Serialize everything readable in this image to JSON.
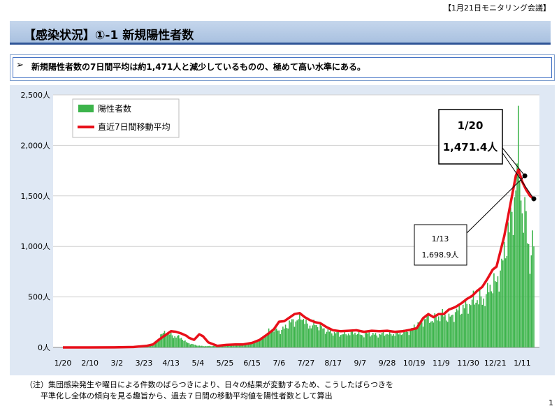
{
  "header": {
    "meeting_label": "【1月21日モニタリング会議】"
  },
  "title": "【感染状況】①-1 新規陽性者数",
  "summary": {
    "marker": "➢",
    "text": "新規陽性者数の7日間平均は約1,471人と減少しているものの、極めて高い水準にある。"
  },
  "note": {
    "line1": "（注）集団感染発生や曜日による件数のばらつきにより、日々の結果が変動するため、こうしたばらつきを",
    "line2": "平準化し全体の傾向を見る趣旨から、過去７日間の移動平均値を陽性者数として算出"
  },
  "page_number": "1",
  "colors": {
    "bars": "#3cb44b",
    "avg_line": "#e8101a",
    "title_band": "#b8cde8",
    "plot_bg": "#ffffff",
    "frame_bg": "#dfe8f4"
  },
  "chart_data": {
    "type": "bar",
    "x_start": "1/20",
    "x_end": "1/20",
    "x_ticks": [
      "1/20",
      "2/10",
      "3/2",
      "3/23",
      "4/13",
      "5/4",
      "5/25",
      "6/15",
      "7/6",
      "7/27",
      "8/17",
      "9/7",
      "9/28",
      "10/19",
      "11/9",
      "11/30",
      "12/21",
      "1/11"
    ],
    "y_ticks": [
      "0人",
      "500人",
      "1,000人",
      "1,500人",
      "2,000人",
      "2,500人"
    ],
    "ylim": [
      0,
      2500
    ],
    "grid": "horizontal",
    "legend": {
      "position": "top-left",
      "bars": "陽性者数",
      "line": "直近7日間移動平均"
    },
    "series": [
      {
        "name": "陽性者数",
        "kind": "bar",
        "points": [
          [
            0,
            0
          ],
          [
            40,
            1
          ],
          [
            60,
            2
          ],
          [
            65,
            6
          ],
          [
            70,
            40
          ],
          [
            73,
            60
          ],
          [
            76,
            150
          ],
          [
            80,
            185
          ],
          [
            86,
            140
          ],
          [
            92,
            120
          ],
          [
            95,
            70
          ],
          [
            100,
            40
          ],
          [
            106,
            20
          ],
          [
            112,
            15
          ],
          [
            120,
            20
          ],
          [
            127,
            25
          ],
          [
            134,
            45
          ],
          [
            140,
            35
          ],
          [
            148,
            60
          ],
          [
            155,
            110
          ],
          [
            160,
            190
          ],
          [
            164,
            230
          ],
          [
            168,
            200
          ],
          [
            172,
            230
          ],
          [
            176,
            300
          ],
          [
            182,
            330
          ],
          [
            186,
            380
          ],
          [
            190,
            260
          ],
          [
            196,
            280
          ],
          [
            200,
            250
          ],
          [
            205,
            200
          ],
          [
            210,
            180
          ],
          [
            216,
            160
          ],
          [
            222,
            170
          ],
          [
            228,
            180
          ],
          [
            232,
            150
          ],
          [
            238,
            170
          ],
          [
            244,
            150
          ],
          [
            250,
            170
          ],
          [
            255,
            160
          ],
          [
            260,
            170
          ],
          [
            265,
            180
          ],
          [
            270,
            200
          ],
          [
            275,
            280
          ],
          [
            278,
            280
          ],
          [
            282,
            360
          ],
          [
            284,
            350
          ],
          [
            288,
            330
          ],
          [
            292,
            380
          ],
          [
            296,
            400
          ],
          [
            300,
            350
          ],
          [
            305,
            420
          ],
          [
            310,
            480
          ],
          [
            314,
            500
          ],
          [
            318,
            560
          ],
          [
            322,
            600
          ],
          [
            326,
            570
          ],
          [
            330,
            660
          ],
          [
            334,
            800
          ],
          [
            337,
            760
          ],
          [
            340,
            950
          ],
          [
            343,
            1100
          ],
          [
            346,
            1450
          ],
          [
            349,
            1500
          ],
          [
            352,
            2050
          ],
          [
            354,
            2400
          ],
          [
            357,
            1700
          ],
          [
            360,
            1500
          ],
          [
            363,
            1100
          ],
          [
            365,
            1200
          ],
          [
            366,
            1250
          ]
        ]
      },
      {
        "name": "直近7日間移動平均",
        "kind": "line",
        "points": [
          [
            0,
            0
          ],
          [
            40,
            1
          ],
          [
            55,
            4
          ],
          [
            65,
            15
          ],
          [
            70,
            30
          ],
          [
            75,
            80
          ],
          [
            80,
            125
          ],
          [
            84,
            160
          ],
          [
            88,
            155
          ],
          [
            92,
            138
          ],
          [
            96,
            115
          ],
          [
            98,
            95
          ],
          [
            102,
            75
          ],
          [
            106,
            130
          ],
          [
            109,
            110
          ],
          [
            113,
            50
          ],
          [
            120,
            15
          ],
          [
            127,
            25
          ],
          [
            134,
            30
          ],
          [
            140,
            30
          ],
          [
            147,
            45
          ],
          [
            153,
            75
          ],
          [
            159,
            130
          ],
          [
            164,
            180
          ],
          [
            168,
            255
          ],
          [
            172,
            260
          ],
          [
            176,
            295
          ],
          [
            180,
            330
          ],
          [
            184,
            340
          ],
          [
            188,
            300
          ],
          [
            192,
            270
          ],
          [
            196,
            250
          ],
          [
            200,
            240
          ],
          [
            205,
            200
          ],
          [
            210,
            170
          ],
          [
            216,
            160
          ],
          [
            222,
            165
          ],
          [
            228,
            170
          ],
          [
            234,
            155
          ],
          [
            240,
            165
          ],
          [
            246,
            160
          ],
          [
            252,
            165
          ],
          [
            258,
            155
          ],
          [
            264,
            160
          ],
          [
            270,
            175
          ],
          [
            275,
            190
          ],
          [
            280,
            290
          ],
          [
            284,
            330
          ],
          [
            288,
            300
          ],
          [
            292,
            330
          ],
          [
            296,
            330
          ],
          [
            300,
            375
          ],
          [
            305,
            400
          ],
          [
            310,
            440
          ],
          [
            314,
            480
          ],
          [
            318,
            510
          ],
          [
            322,
            560
          ],
          [
            326,
            600
          ],
          [
            330,
            680
          ],
          [
            334,
            770
          ],
          [
            337,
            800
          ],
          [
            340,
            950
          ],
          [
            343,
            1100
          ],
          [
            346,
            1300
          ],
          [
            349,
            1500
          ],
          [
            352,
            1698.9
          ],
          [
            354,
            1760
          ],
          [
            357,
            1640
          ],
          [
            360,
            1560
          ],
          [
            363,
            1500
          ],
          [
            366,
            1471.4
          ]
        ]
      }
    ],
    "annotations": [
      {
        "label_date": "1/20",
        "label_value": "1,471.4人",
        "day": 366,
        "value": 1471.4
      },
      {
        "label_date": "1/13",
        "label_value": "1,698.9人",
        "day": 359,
        "value": 1698.9
      }
    ]
  }
}
